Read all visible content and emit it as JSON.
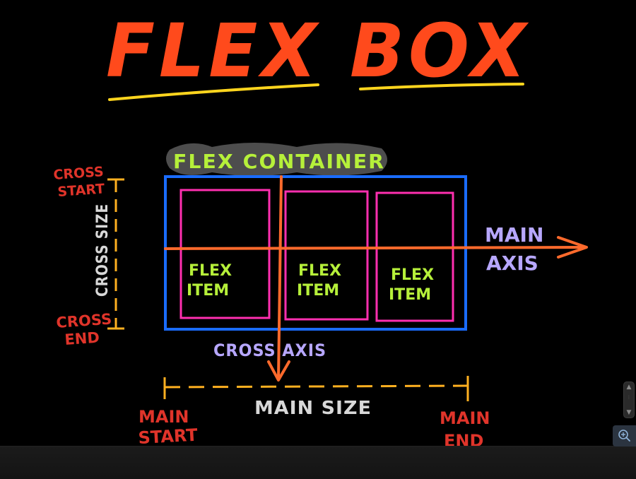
{
  "title": "FLEX BOX",
  "labels": {
    "flex_container": "FLEX CONTAINER",
    "flex_item": [
      "FLEX",
      "ITEM"
    ],
    "main_axis": [
      "MAIN",
      "AXIS"
    ],
    "cross_axis": "CROSS AXIS",
    "main_size": "MAIN SIZE",
    "cross_size": "CROSS SIZE",
    "cross_start": [
      "CROSS",
      "START"
    ],
    "cross_end": [
      "CROSS",
      "END"
    ],
    "main_start": [
      "MAIN",
      "START"
    ],
    "main_end": [
      "MAIN",
      "END"
    ]
  },
  "colors": {
    "title": "#ff4a1c",
    "underline": "#ffd51e",
    "container_border": "#1a6cff",
    "item_border": "#ff2fb0",
    "item_text": "#b6f03a",
    "container_label": "#b6f03a",
    "container_label_highlight": "#5a5a5a",
    "axis_arrows": "#ff6a2c",
    "axis_text": "#b7a7ff",
    "size_text": "#d8d8d8",
    "marker": "#ffb020",
    "start_end_text": "#e0342a"
  },
  "viewer": {
    "step_up": "▲",
    "step_down": "▼",
    "zoom_icon": "zoom-in-icon"
  }
}
